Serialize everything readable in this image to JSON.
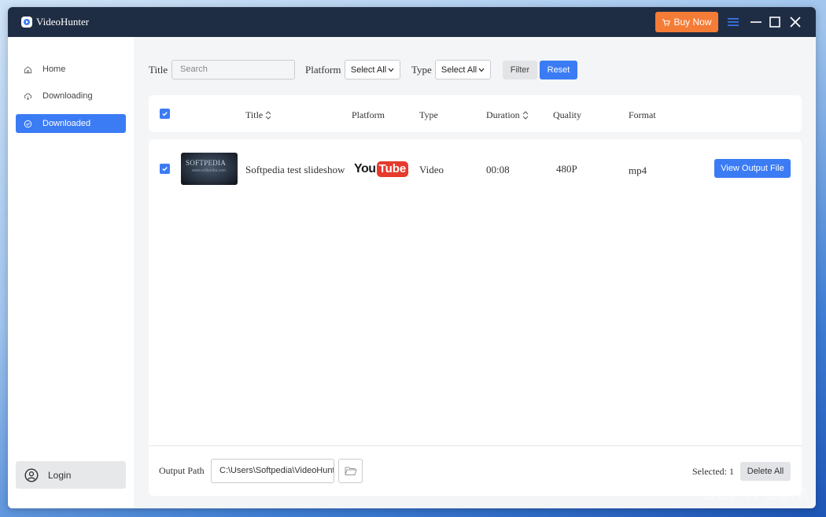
{
  "app": {
    "title": "VideoHunter",
    "buy_now_label": "Buy Now"
  },
  "sidebar": {
    "items": [
      {
        "label": "Home",
        "icon": "home-icon"
      },
      {
        "label": "Downloading",
        "icon": "cloud-download-icon"
      },
      {
        "label": "Downloaded",
        "icon": "check-circle-icon",
        "active": true
      }
    ],
    "login_label": "Login"
  },
  "filters": {
    "title_label": "Title",
    "search_placeholder": "Search",
    "platform_label": "Platform",
    "platform_value": "Select All",
    "type_label": "Type",
    "type_value": "Select All",
    "filter_label": "Filter",
    "reset_label": "Reset"
  },
  "table": {
    "columns": {
      "title": "Title",
      "platform": "Platform",
      "type": "Type",
      "duration": "Duration",
      "quality": "Quality",
      "format": "Format"
    },
    "rows": [
      {
        "checked": true,
        "thumbnail_text": "SOFTPEDIA",
        "thumbnail_subtext": "www.softpedia.com",
        "title": "Softpedia test slideshow",
        "platform": "YouTube",
        "platform_you": "You",
        "platform_tube": "Tube",
        "type": "Video",
        "duration": "00:08",
        "quality": "480P",
        "format": "mp4",
        "action_label": "View Output File"
      }
    ]
  },
  "footer": {
    "output_path_label": "Output Path",
    "output_path_value": "C:\\Users\\Softpedia\\VideoHunter",
    "selected_text": "Selected: 1",
    "delete_all_label": "Delete All"
  },
  "watermark": "SOFTPEDIA",
  "colors": {
    "accent": "#3b7cf5",
    "titlebar": "#1f2d44",
    "buy_button": "#f57c36",
    "youtube_red": "#e53a2c"
  }
}
